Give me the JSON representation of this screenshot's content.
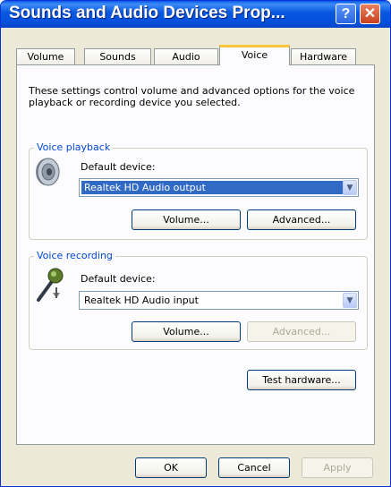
{
  "window": {
    "title": "Sounds and Audio Devices Prop..."
  },
  "titlebar": {
    "help_glyph": "?",
    "close_glyph": "✕"
  },
  "tabs": [
    {
      "label": "Volume"
    },
    {
      "label": "Sounds"
    },
    {
      "label": "Audio"
    },
    {
      "label": "Voice"
    },
    {
      "label": "Hardware"
    }
  ],
  "active_tab": "Voice",
  "description": "These settings control volume and advanced options for the voice playback or recording device you selected.",
  "voice_playback": {
    "legend": "Voice playback",
    "default_device_label": "Default device:",
    "selected_device": "Realtek HD Audio output",
    "volume_button": "Volume...",
    "advanced_button": "Advanced..."
  },
  "voice_recording": {
    "legend": "Voice recording",
    "default_device_label": "Default device:",
    "selected_device": "Realtek HD Audio input",
    "volume_button": "Volume...",
    "advanced_button": "Advanced..."
  },
  "test_hardware_button": "Test hardware...",
  "footer": {
    "ok": "OK",
    "cancel": "Cancel",
    "apply": "Apply"
  },
  "colors": {
    "titlebar": "#0454E0",
    "group_legend": "#0046D5",
    "selection": "#316AC5",
    "tab_highlight": "#FFC83C"
  },
  "icons": {
    "playback": "speaker-icon",
    "recording": "microphone-icon",
    "dropdown": "chevron-down-icon"
  }
}
